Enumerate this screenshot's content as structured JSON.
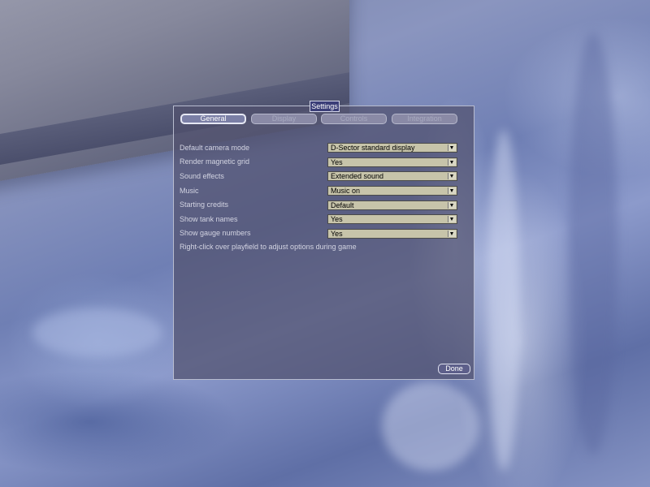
{
  "dialog": {
    "title": "Settings"
  },
  "tabs": [
    {
      "label": "General",
      "active": true
    },
    {
      "label": "Display",
      "active": false
    },
    {
      "label": "Controls",
      "active": false
    },
    {
      "label": "Integration",
      "active": false
    }
  ],
  "settings": [
    {
      "label": "Default camera mode",
      "value": "D-Sector standard display"
    },
    {
      "label": "Render magnetic grid",
      "value": "Yes"
    },
    {
      "label": "Sound effects",
      "value": "Extended sound"
    },
    {
      "label": "Music",
      "value": "Music on"
    },
    {
      "label": "Starting credits",
      "value": "Default"
    },
    {
      "label": "Show tank names",
      "value": "Yes"
    },
    {
      "label": "Show gauge numbers",
      "value": "Yes"
    }
  ],
  "hint": "Right-click over playfield to adjust options during game",
  "done_label": "Done",
  "colors": {
    "panel": "#50506e",
    "title_bg": "#3b3e78",
    "select_bg": "#c7c4aa",
    "label_text": "#d3d4e2"
  },
  "icons": {
    "dropdown": "chevron-down-icon"
  }
}
